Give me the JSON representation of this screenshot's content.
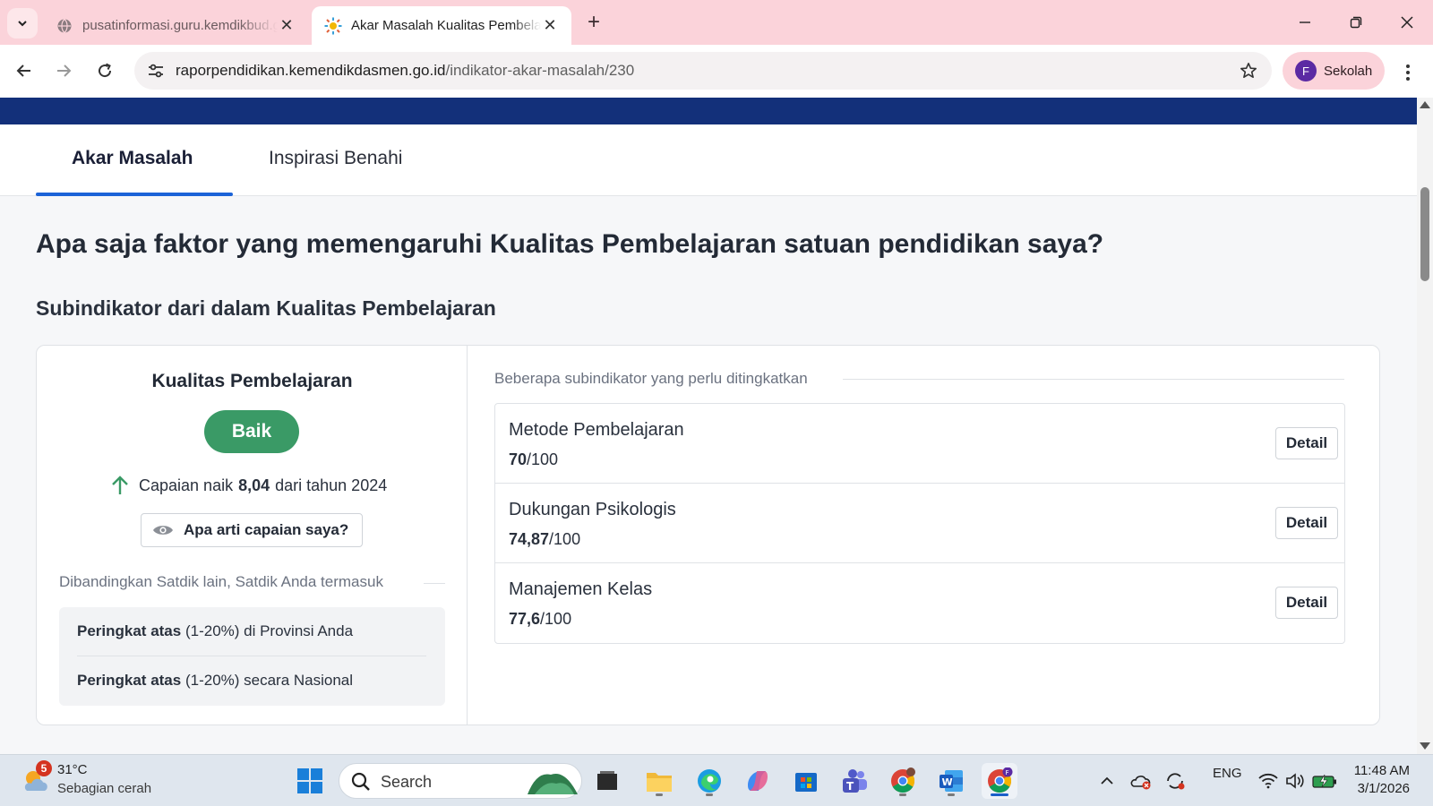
{
  "browser": {
    "tabs": [
      {
        "title": "pusatinformasi.guru.kemdikbud.go.id",
        "active": false
      },
      {
        "title": "Akar Masalah Kualitas Pembelajaran",
        "active": true
      }
    ],
    "url_host": "raporpendidikan.kemendikdasmen.go.id",
    "url_path": "/indikator-akar-masalah/230",
    "profile_initial": "F",
    "profile_name": "Sekolah"
  },
  "page": {
    "tabs": [
      "Akar Masalah",
      "Inspirasi Benahi"
    ],
    "active_tab": "Akar Masalah",
    "heading": "Apa saja faktor yang memengaruhi Kualitas Pembelajaran satuan pendidikan saya?",
    "subheading": "Subindikator dari dalam Kualitas Pembelajaran",
    "summary": {
      "title": "Kualitas Pembelajaran",
      "status": "Baik",
      "status_color": "#3a9a66",
      "trend_prefix": "Capaian naik",
      "trend_value": "8,04",
      "trend_suffix": "dari tahun 2024",
      "meaning_button": "Apa arti capaian saya?",
      "compare_label": "Dibandingkan Satdik lain, Satdik Anda termasuk",
      "ranks": [
        {
          "bold": "Peringkat atas",
          "rest": " (1-20%) di Provinsi Anda"
        },
        {
          "bold": "Peringkat atas",
          "rest": " (1-20%) secara Nasional"
        }
      ]
    },
    "subindicators_label": "Beberapa subindikator yang perlu ditingkatkan",
    "subindicators": [
      {
        "name": "Metode Pembelajaran",
        "score": "70",
        "max": "/100",
        "button": "Detail"
      },
      {
        "name": "Dukungan Psikologis",
        "score": "74,87",
        "max": "/100",
        "button": "Detail"
      },
      {
        "name": "Manajemen Kelas",
        "score": "77,6",
        "max": "/100",
        "button": "Detail"
      }
    ]
  },
  "taskbar": {
    "weather_badge": "5",
    "temperature": "31°C",
    "condition": "Sebagian cerah",
    "search_placeholder": "Search",
    "language": "ENG",
    "time": "11:48 AM",
    "date": "3/1/2026"
  },
  "colors": {
    "header_band": "#13307a",
    "tab_accent": "#1b63d8",
    "chrome_pink": "#fbd3da"
  }
}
